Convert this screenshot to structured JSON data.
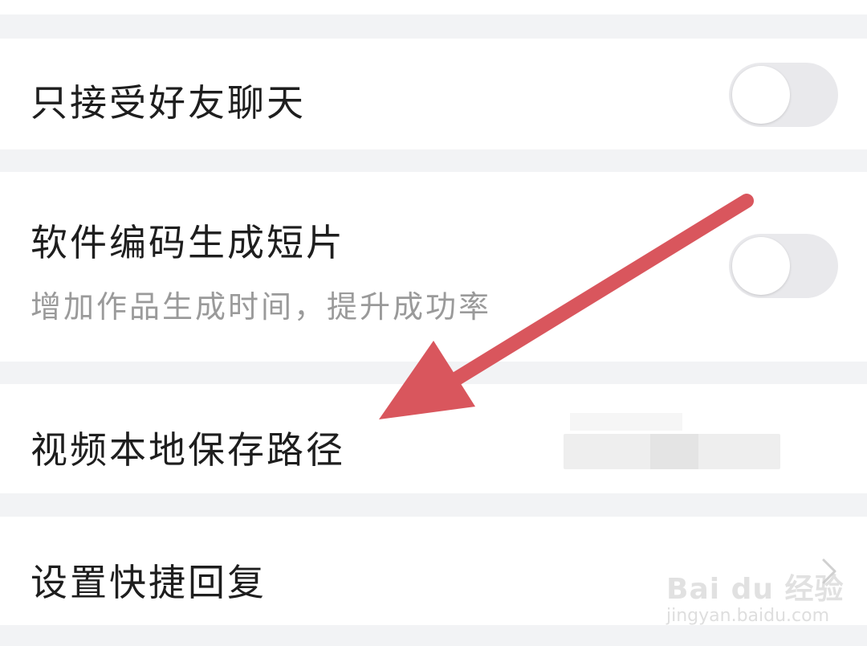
{
  "settings": {
    "items": [
      {
        "label": "只接受好友聊天",
        "control": "toggle",
        "enabled": false
      },
      {
        "label": "软件编码生成短片",
        "sublabel": "增加作品生成时间，提升成功率",
        "control": "toggle",
        "enabled": false
      },
      {
        "label": "视频本地保存路径",
        "control": "value",
        "value_redacted": true
      },
      {
        "label": "设置快捷回复",
        "control": "chevron"
      }
    ]
  },
  "icons": {
    "chevron": "chevron-right-icon"
  },
  "annotation": {
    "type": "arrow",
    "color": "#d9565d",
    "points_to": "视频本地保存路径"
  },
  "watermark": {
    "brand": "Bai du 经验",
    "url": "jingyan.baidu.com"
  },
  "colors": {
    "background": "#f2f3f5",
    "row": "#ffffff",
    "toggle_off": "#e9e9ec",
    "text": "#1e1e1e",
    "subtext": "#9a9a9a"
  }
}
